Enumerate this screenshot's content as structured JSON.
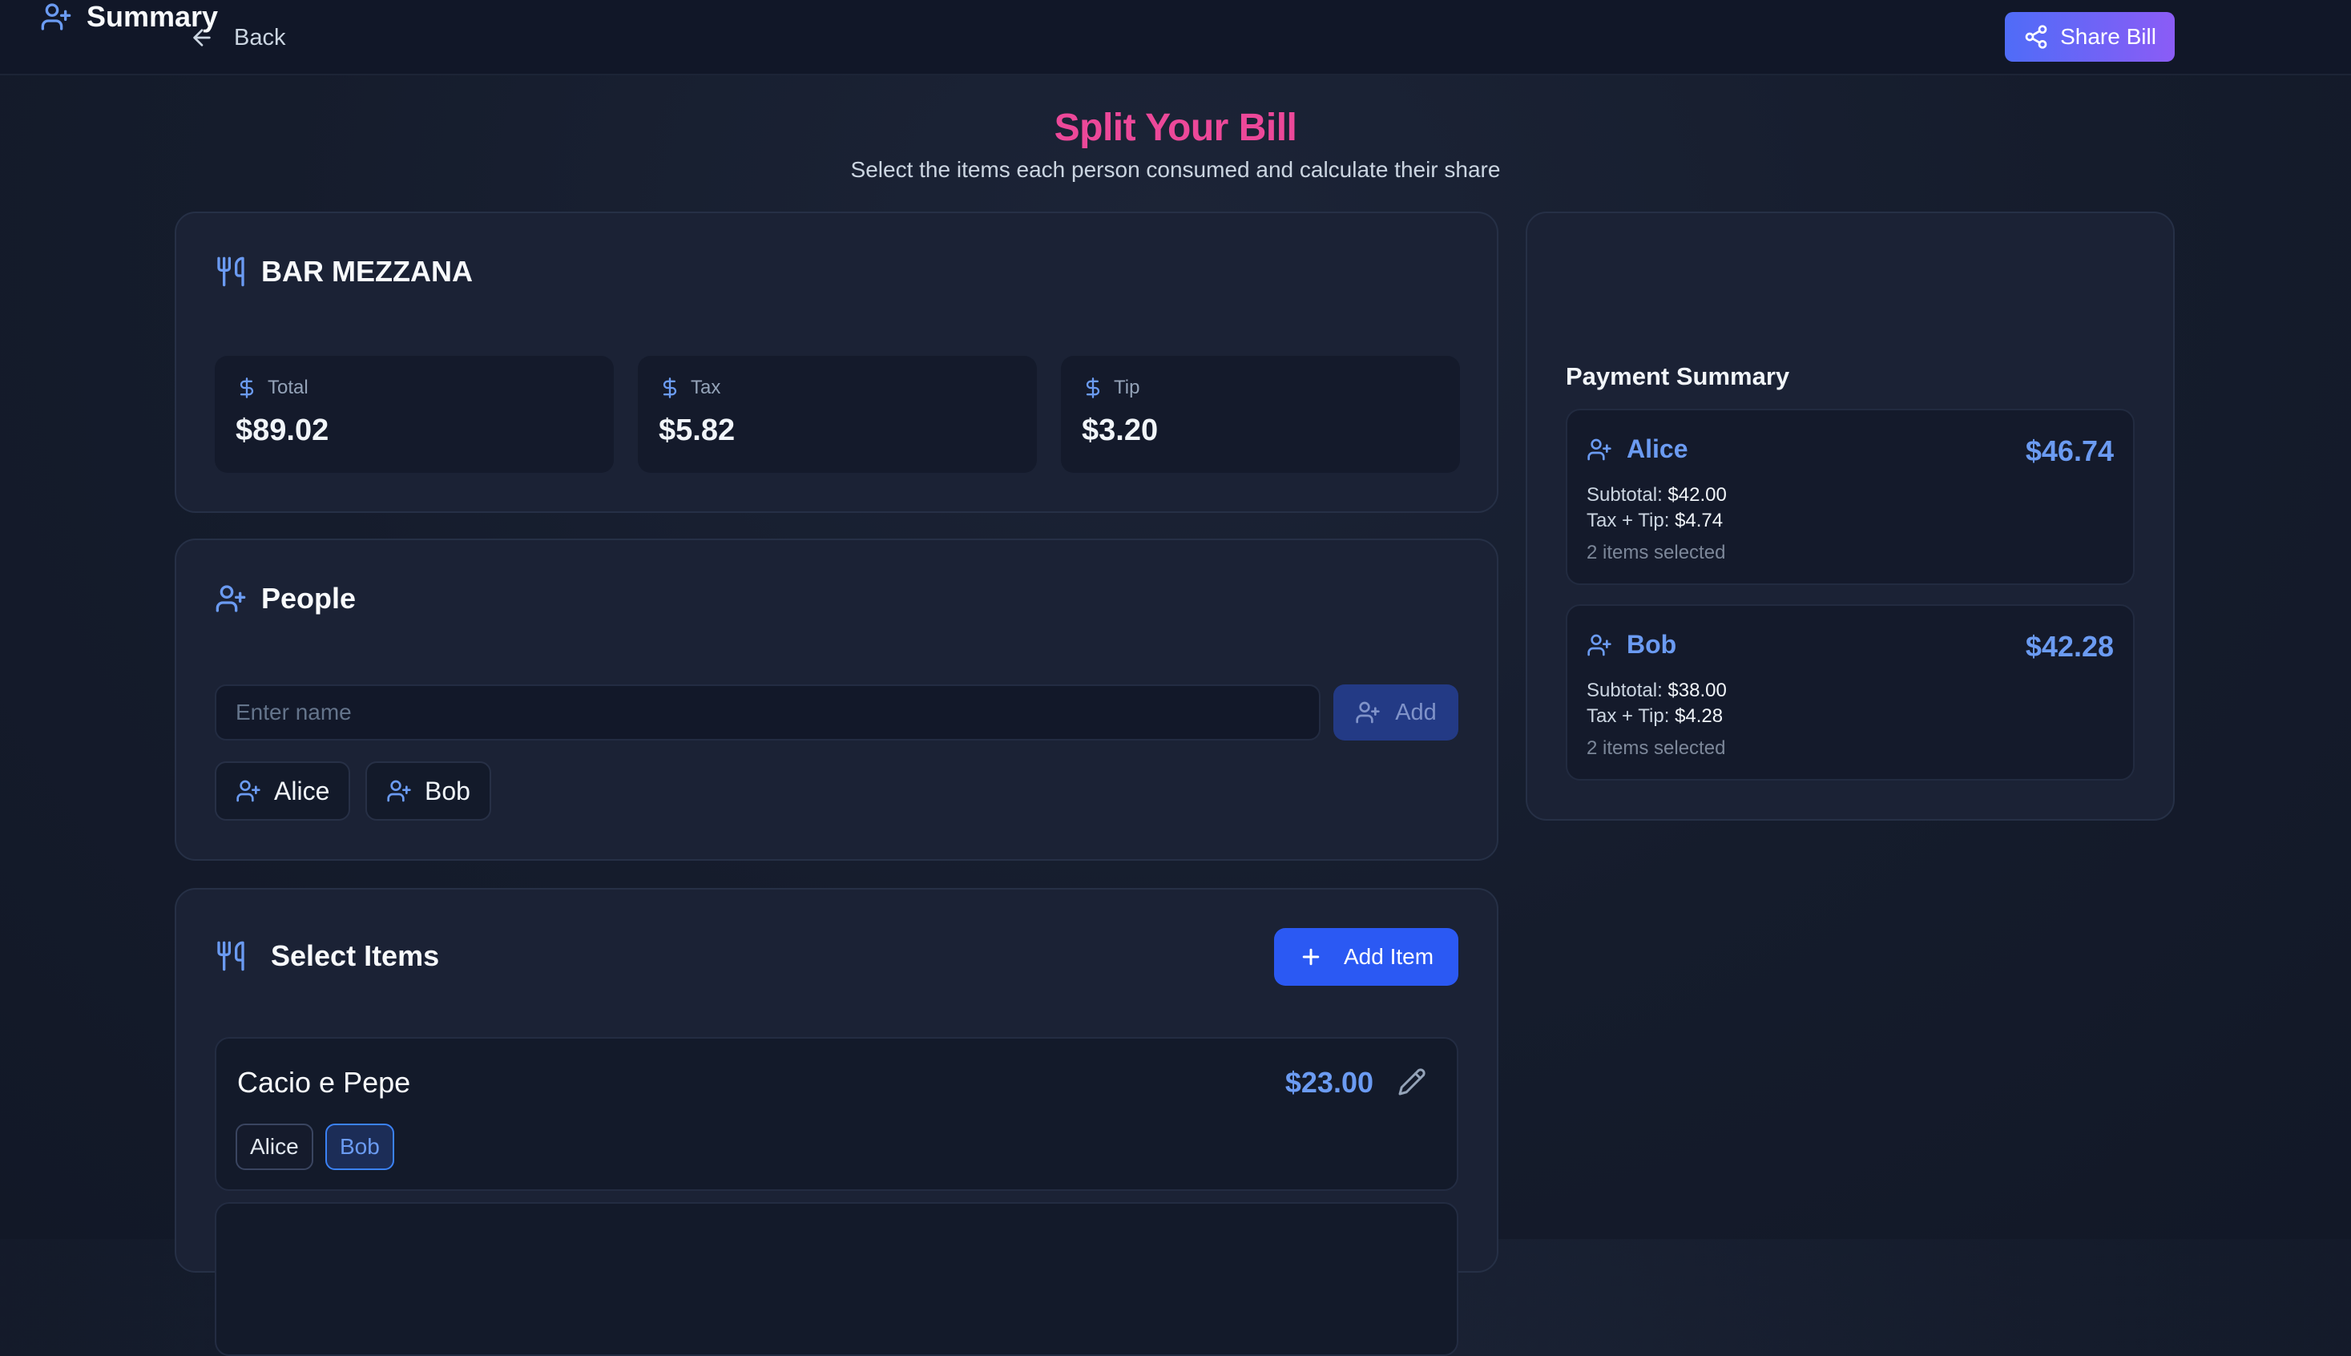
{
  "header": {
    "back_label": "Back",
    "share_label": "Share Bill"
  },
  "page": {
    "title": "Split Your Bill",
    "subtitle": "Select the items each person consumed and calculate their share"
  },
  "restaurant": {
    "name": "BAR MEZZANA",
    "stats": [
      {
        "label": "Total",
        "value": "$89.02"
      },
      {
        "label": "Tax",
        "value": "$5.82"
      },
      {
        "label": "Tip",
        "value": "$3.20"
      }
    ]
  },
  "people": {
    "title": "People",
    "input_placeholder": "Enter name",
    "input_value": "",
    "add_label": "Add",
    "list": [
      "Alice",
      "Bob"
    ]
  },
  "items": {
    "title": "Select Items",
    "add_label": "Add Item",
    "list": [
      {
        "name": "Cacio e Pepe",
        "price": "$23.00",
        "assignees": [
          {
            "name": "Alice",
            "selected": false
          },
          {
            "name": "Bob",
            "selected": true
          }
        ]
      }
    ]
  },
  "summary": {
    "title": "Summary",
    "payment_title": "Payment Summary",
    "persons": [
      {
        "name": "Alice",
        "total": "$46.74",
        "subtotal_label": "Subtotal:",
        "subtotal": "$42.00",
        "taxtip_label": "Tax + Tip:",
        "taxtip": "$4.74",
        "items_selected": "2 items selected"
      },
      {
        "name": "Bob",
        "total": "$42.28",
        "subtotal_label": "Subtotal:",
        "subtotal": "$38.00",
        "taxtip_label": "Tax + Tip:",
        "taxtip": "$4.28",
        "items_selected": "2 items selected"
      }
    ]
  },
  "colors": {
    "accent": "#2b59f3",
    "title_pink": "#ec4899",
    "selected_blue": "#6b9bf2",
    "background": "#151c2c"
  },
  "icons": {
    "back": "arrow-left-icon",
    "share": "share-icon",
    "restaurant": "utensils-icon",
    "money": "dollar-icon",
    "person": "user-plus-icon",
    "add": "plus-icon",
    "edit": "pencil-icon"
  }
}
